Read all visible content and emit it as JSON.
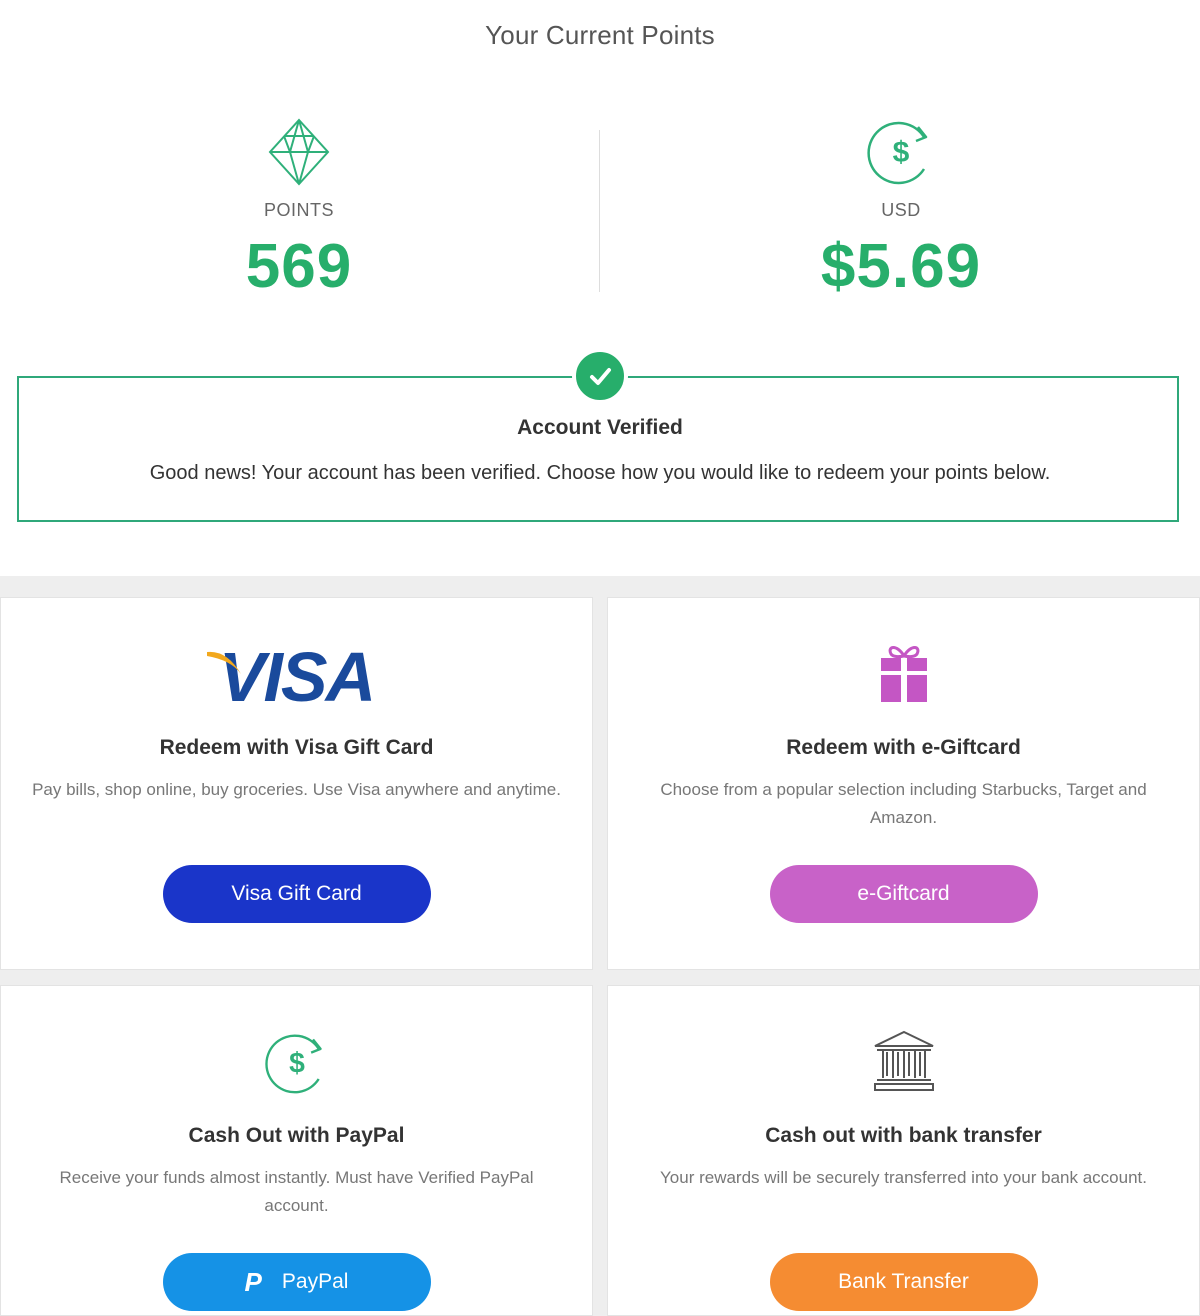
{
  "header": {
    "title": "Your Current Points"
  },
  "stats": {
    "points": {
      "icon": "diamond-icon",
      "label": "POINTS",
      "value": "569"
    },
    "usd": {
      "icon": "dollar-refresh-icon",
      "label": "USD",
      "value": "$5.69"
    }
  },
  "verification": {
    "icon": "check-circle-icon",
    "title": "Account Verified",
    "message": "Good news! Your account has been verified. Choose how you would like to redeem your points below."
  },
  "options": [
    {
      "icon": "visa-logo",
      "logo_text": "VISA",
      "title": "Redeem with Visa Gift Card",
      "description": "Pay bills, shop online, buy groceries. Use Visa anywhere and anytime.",
      "button_label": "Visa Gift Card",
      "button_color": "#1a35c9"
    },
    {
      "icon": "gift-icon",
      "title": "Redeem with e-Giftcard",
      "description": "Choose from a popular selection including Starbucks, Target and Amazon.",
      "button_label": "e-Giftcard",
      "button_color": "#c862c8"
    },
    {
      "icon": "dollar-refresh-icon",
      "title": "Cash Out with PayPal",
      "description": "Receive your funds almost instantly. Must have Verified PayPal account.",
      "button_label": "PayPal",
      "button_glyph": "P",
      "button_color": "#1592e6"
    },
    {
      "icon": "bank-icon",
      "title": "Cash out with bank transfer",
      "description": "Your rewards will be securely transferred into your bank account.",
      "button_label": "Bank Transfer",
      "button_color": "#f58c32"
    }
  ],
  "colors": {
    "accent_green": "#27ae6b",
    "border_green": "#2fa87a"
  }
}
